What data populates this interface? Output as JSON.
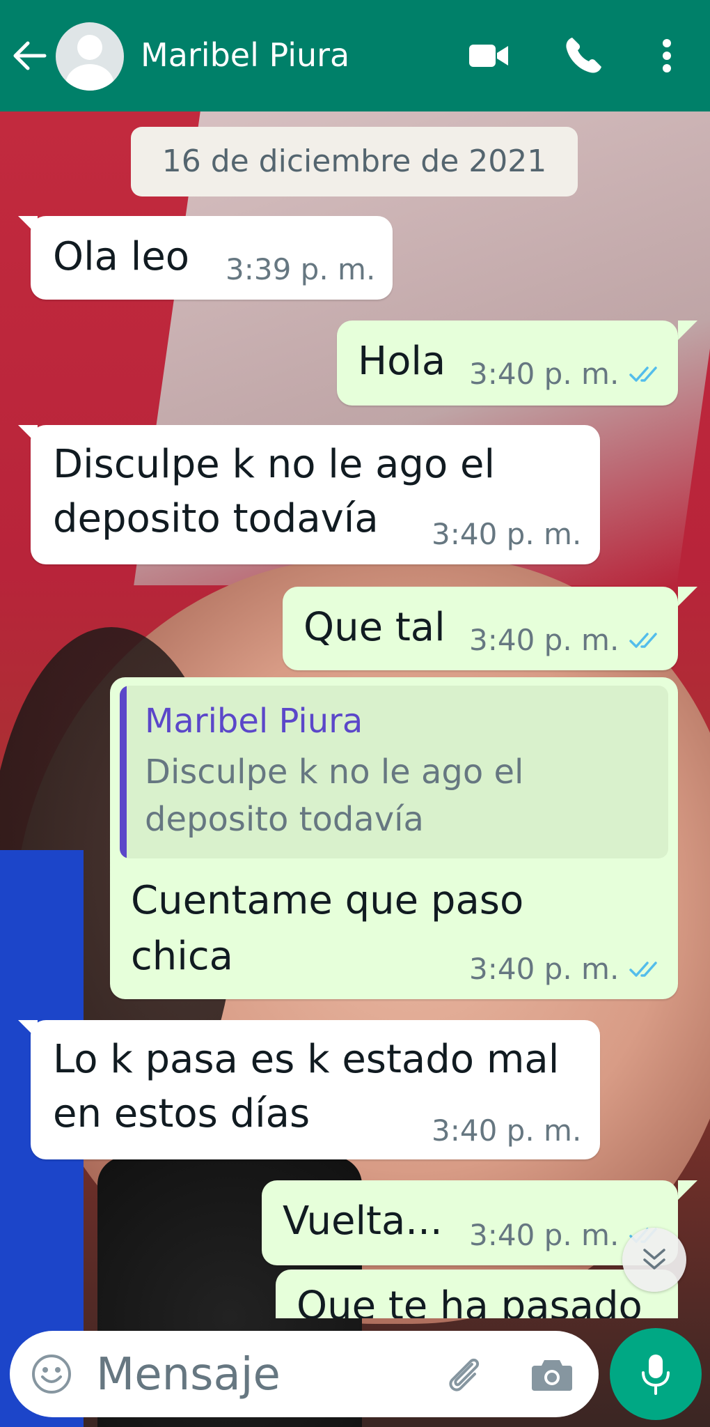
{
  "header": {
    "contact_name": "Maribel Piura",
    "icons": [
      "back-arrow-icon",
      "avatar-icon",
      "video-call-icon",
      "phone-call-icon",
      "more-vert-icon"
    ],
    "bg_color": "#008069"
  },
  "chat": {
    "date_chip": "16 de diciembre de 2021",
    "messages": [
      {
        "direction": "in",
        "text": "Ola leo",
        "time": "3:39 p. m."
      },
      {
        "direction": "out",
        "text": "Hola",
        "time": "3:40 p. m.",
        "status": "read"
      },
      {
        "direction": "in",
        "lines": [
          "Disculpe k no le ago el",
          "deposito todavía"
        ],
        "time": "3:40 p. m."
      },
      {
        "direction": "out",
        "text": "Que tal",
        "time": "3:40 p. m.",
        "status": "read"
      },
      {
        "direction": "out",
        "reply": {
          "name": "Maribel Piura",
          "lines": [
            "Disculpe k no le ago el",
            "deposito todavía"
          ]
        },
        "lines": [
          "Cuentame que paso",
          "chica"
        ],
        "time": "3:40 p. m.",
        "status": "read"
      },
      {
        "direction": "in",
        "lines": [
          "Lo k pasa es k estado mal",
          "en estos días"
        ],
        "time": "3:40 p. m."
      },
      {
        "direction": "out",
        "text": "Vuelta...",
        "time": "3:40 p. m.",
        "status": "read"
      },
      {
        "direction": "out",
        "text": "Que te ha pasado",
        "partial": true
      }
    ],
    "colors": {
      "incoming": "#ffffff",
      "outgoing": "#e6ffda",
      "reply_name": "#5b47c9",
      "read_tick": "#53bdeb"
    }
  },
  "composer": {
    "placeholder": "Mensaje",
    "icons": [
      "emoji-icon",
      "attach-icon",
      "camera-icon",
      "mic-icon"
    ],
    "mic_color": "#00a884"
  }
}
